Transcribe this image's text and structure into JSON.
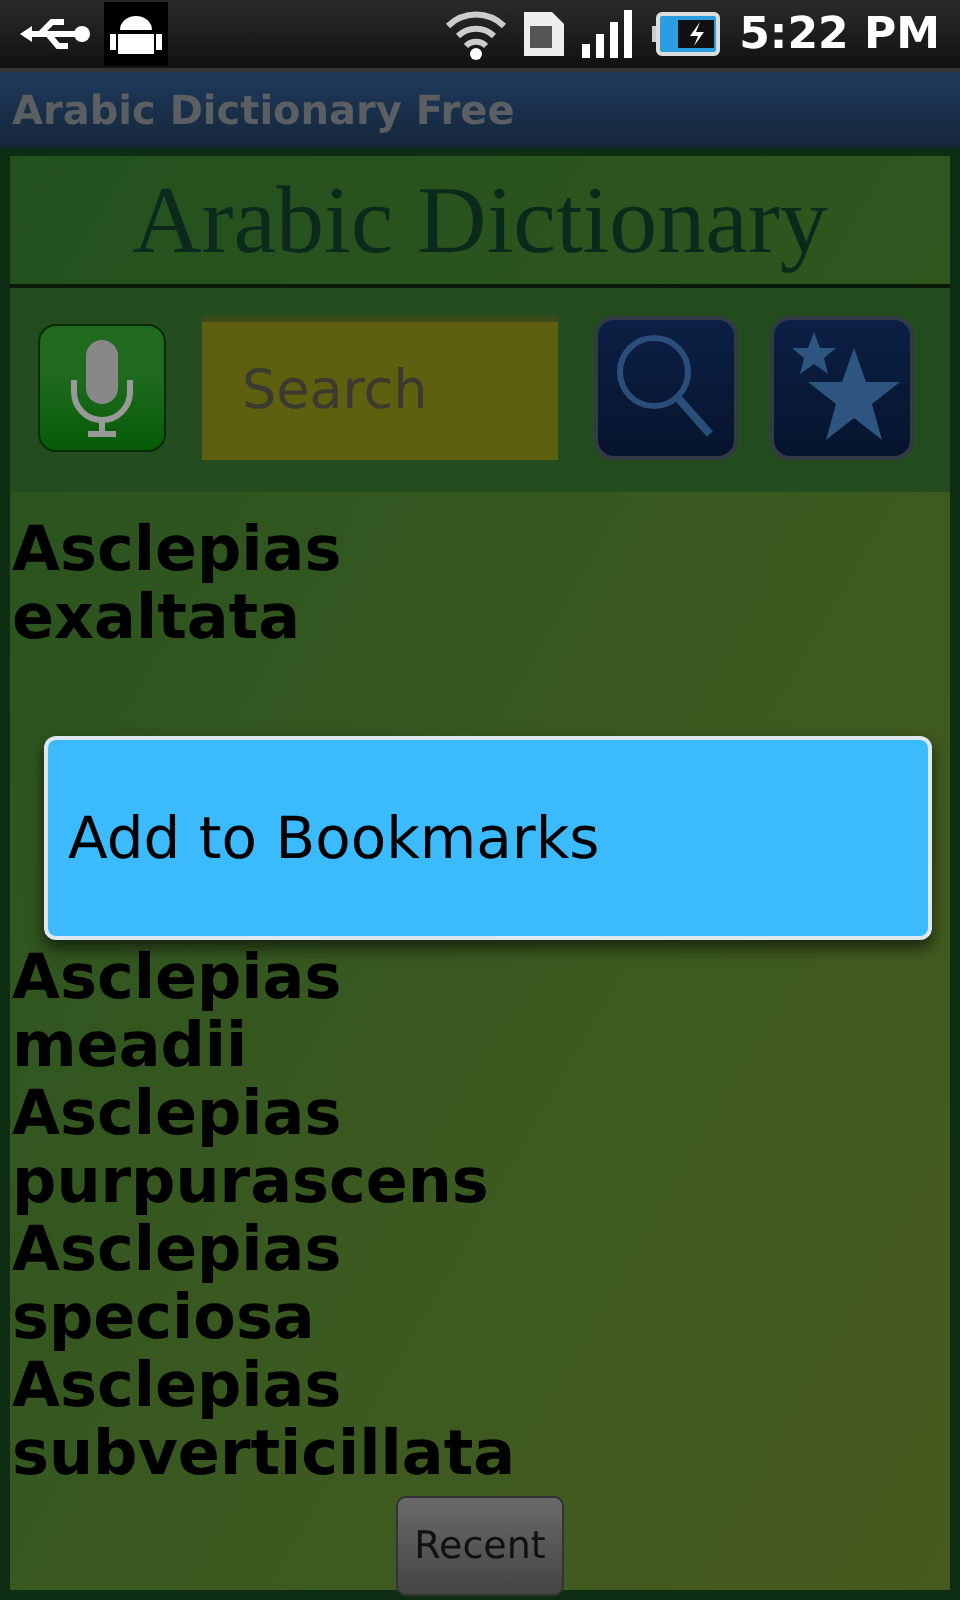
{
  "status_bar": {
    "time": "5:22 PM"
  },
  "window": {
    "title": "Arabic Dictionary Free"
  },
  "header": {
    "title": "Arabic Dictionary"
  },
  "search": {
    "placeholder": "Search"
  },
  "words": [
    {
      "text": "Asclepias exaltata"
    },
    {
      "text": "Asclepias meadii"
    },
    {
      "text": "Asclepias purpurascens"
    },
    {
      "text": "Asclepias speciosa"
    },
    {
      "text": "Asclepias subverticillata"
    }
  ],
  "context_menu": {
    "items": [
      {
        "label": "Add to Bookmarks",
        "selected": true
      }
    ]
  },
  "recent_button": {
    "label": "Recent"
  }
}
